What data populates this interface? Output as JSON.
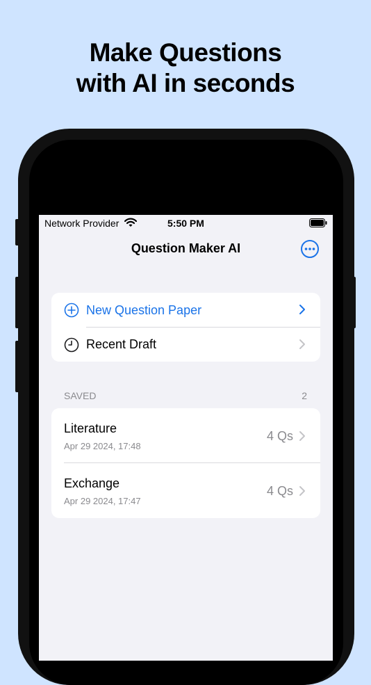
{
  "headline": {
    "line1": "Make Questions",
    "line2": "with AI in seconds"
  },
  "status_bar": {
    "provider": "Network Provider",
    "time": "5:50 PM"
  },
  "nav": {
    "title": "Question Maker AI",
    "more_icon": "ellipsis-circle-icon"
  },
  "actions": [
    {
      "label": "New Question Paper",
      "icon": "plus-circle-icon",
      "color": "#1a73e8"
    },
    {
      "label": "Recent Draft",
      "icon": "clock-icon",
      "color": "#000000"
    }
  ],
  "saved": {
    "header": "SAVED",
    "count": "2",
    "items": [
      {
        "title": "Literature",
        "date": "Apr 29 2024, 17:48",
        "questions": "4 Qs"
      },
      {
        "title": "Exchange",
        "date": "Apr 29 2024, 17:47",
        "questions": "4 Qs"
      }
    ]
  },
  "colors": {
    "background": "#cfe4ff",
    "accent": "#1a73e8",
    "screen": "#f2f2f7"
  }
}
